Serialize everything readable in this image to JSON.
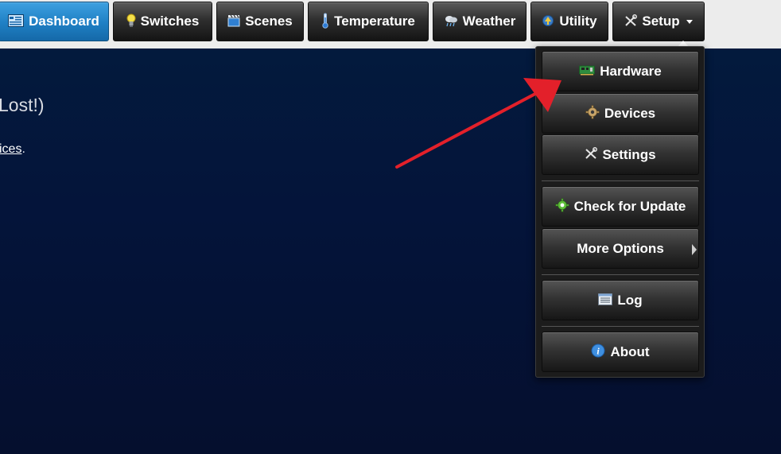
{
  "nav": {
    "items": [
      {
        "label": "Dashboard",
        "icon": "dashboard-icon",
        "active": true
      },
      {
        "label": "Switches",
        "icon": "lightbulb-icon"
      },
      {
        "label": "Scenes",
        "icon": "clapperboard-icon"
      },
      {
        "label": "Temperature",
        "icon": "thermometer-icon"
      },
      {
        "label": "Weather",
        "icon": "weather-cloud-icon"
      },
      {
        "label": "Utility",
        "icon": "utility-icon"
      },
      {
        "label": "Setup",
        "icon": "tools-icon"
      }
    ]
  },
  "content": {
    "heading": "Lost!)",
    "line_link": "ices",
    "line_suffix": "."
  },
  "setup_menu": {
    "items": [
      {
        "label": "Hardware",
        "icon": "hardware-board-icon"
      },
      {
        "label": "Devices",
        "icon": "gear-icon"
      },
      {
        "label": "Settings",
        "icon": "tools-icon"
      },
      {
        "label": "Check for Update",
        "icon": "update-gear-icon"
      },
      {
        "label": "More Options",
        "icon": "submenu-arrow-icon"
      },
      {
        "label": "Log",
        "icon": "log-list-icon"
      },
      {
        "label": "About",
        "icon": "info-icon"
      }
    ]
  },
  "colors": {
    "active_tab": "#1f7fc4",
    "content_bg": "#04143a",
    "annotation_arrow": "#e3202a"
  }
}
